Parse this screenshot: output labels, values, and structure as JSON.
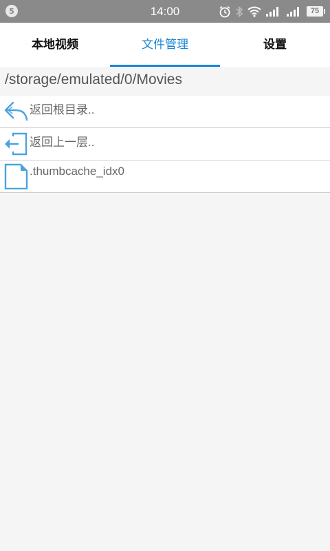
{
  "status_bar": {
    "notification_badge": "5",
    "time": "14:00",
    "battery": "75",
    "icons": [
      "alarm-icon",
      "bluetooth-icon",
      "wifi-icon",
      "signal-icon",
      "signal-icon",
      "battery-icon"
    ]
  },
  "tabs": [
    {
      "label": "本地视频",
      "active": false
    },
    {
      "label": "文件管理",
      "active": true
    },
    {
      "label": "设置",
      "active": false
    }
  ],
  "current_path": "/storage/emulated/0/Movies",
  "files": [
    {
      "label": "返回根目录..",
      "icon": "back-arrow-icon"
    },
    {
      "label": "返回上一层..",
      "icon": "exit-folder-icon"
    },
    {
      "label": ".thumbcache_idx0",
      "icon": "file-icon"
    }
  ],
  "colors": {
    "accent": "#1a85d6",
    "status_bar": "#8a8a8a",
    "icon_blue": "#4aa3df",
    "background": "#f5f5f5"
  }
}
